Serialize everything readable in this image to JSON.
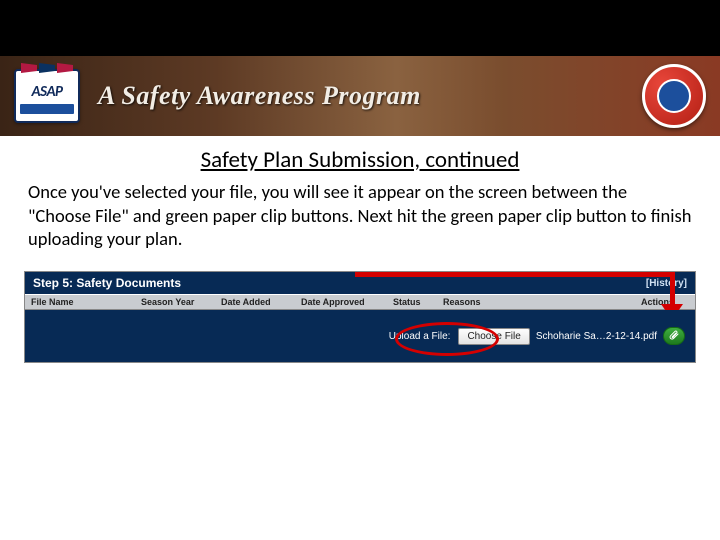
{
  "banner": {
    "asap_label": "ASAP",
    "program_text": "A Safety Awareness Program"
  },
  "page": {
    "title": "Safety Plan Submission, continued",
    "instruction": "Once you've selected your file, you will see it appear on the screen between the \"Choose File\" and green paper clip buttons. Next hit the green paper clip button to finish uploading your plan."
  },
  "step": {
    "heading": "Step 5: Safety Documents",
    "history_label": "[History]",
    "columns": {
      "file_name": "File Name",
      "season_year": "Season Year",
      "date_added": "Date Added",
      "date_approved": "Date Approved",
      "status": "Status",
      "reasons": "Reasons",
      "actions": "Actions"
    },
    "upload": {
      "label": "Upload a File:",
      "button_label": "Choose File",
      "selected_file": "Schoharie Sa…2-12-14.pdf"
    }
  }
}
